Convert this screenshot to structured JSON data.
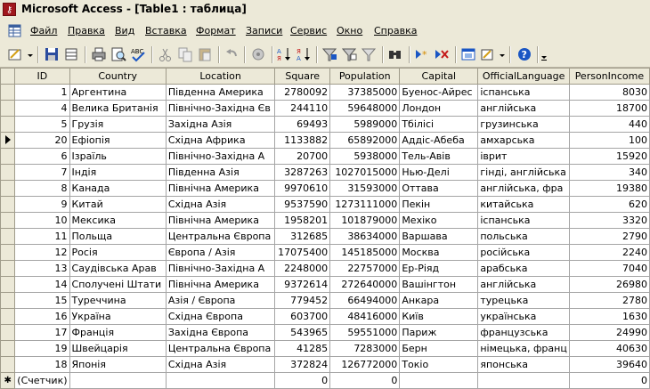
{
  "window": {
    "title": "Microsoft Access - [Table1 : таблица]",
    "app_icon": "access-key-icon"
  },
  "menu": [
    {
      "label": "Файл"
    },
    {
      "label": "Правка"
    },
    {
      "label": "Вид"
    },
    {
      "label": "Вставка"
    },
    {
      "label": "Формат"
    },
    {
      "label": "Записи"
    },
    {
      "label": "Сервис"
    },
    {
      "label": "Окно"
    },
    {
      "label": "Справка"
    }
  ],
  "toolbar": {
    "icons": [
      "design-view-icon",
      "save-icon",
      "print-icon",
      "print-preview-icon",
      "spelling-icon",
      "cut-icon",
      "copy-icon",
      "paste-icon",
      "undo-icon",
      "hyperlink-icon",
      "sort-ascending-icon",
      "sort-descending-icon",
      "filter-by-selection-icon",
      "filter-by-form-icon",
      "apply-filter-icon",
      "find-icon",
      "new-record-icon",
      "delete-record-icon",
      "database-window-icon",
      "new-object-icon",
      "help-icon"
    ]
  },
  "table": {
    "columns": [
      "ID",
      "Country",
      "Location",
      "Square",
      "Population",
      "Capital",
      "OfficialLanguage",
      "PersonIncome"
    ],
    "rows": [
      [
        "1",
        "Аргентина",
        "Південна Америка",
        "2780092",
        "37385000",
        "Буенос-Айрес",
        "іспанська",
        "8030"
      ],
      [
        "4",
        "Велика Британія",
        "Північно-Західна Єв",
        "244110",
        "59648000",
        "Лондон",
        "англійська",
        "18700"
      ],
      [
        "5",
        "Грузія",
        "Західна Азія",
        "69493",
        "5989000",
        "Тбілісі",
        "грузинська",
        "440"
      ],
      [
        "20",
        "Ефіопія",
        "Східна Африка",
        "1133882",
        "65892000",
        "Аддіс-Абеба",
        "амхарська",
        "100"
      ],
      [
        "6",
        "Ізраїль",
        "Північно-Західна А",
        "20700",
        "5938000",
        "Тель-Авів",
        "іврит",
        "15920"
      ],
      [
        "7",
        "Індія",
        "Південна Азія",
        "3287263",
        "1027015000",
        "Нью-Делі",
        "гінді, англійська",
        "340"
      ],
      [
        "8",
        "Канада",
        "Північна Америка",
        "9970610",
        "31593000",
        "Оттава",
        "англійська, фра",
        "19380"
      ],
      [
        "9",
        "Китай",
        "Східна Азія",
        "9537590",
        "1273111000",
        "Пекін",
        "китайська",
        "620"
      ],
      [
        "10",
        "Мексика",
        "Північна Америка",
        "1958201",
        "101879000",
        "Мехіко",
        "іспанська",
        "3320"
      ],
      [
        "11",
        "Польща",
        "Центральна Європа",
        "312685",
        "38634000",
        "Варшава",
        "польська",
        "2790"
      ],
      [
        "12",
        "Росія",
        "Європа / Азія",
        "17075400",
        "145185000",
        "Москва",
        "російська",
        "2240"
      ],
      [
        "13",
        "Саудівська Арав",
        "Північно-Західна А",
        "2248000",
        "22757000",
        "Ер-Ріяд",
        "арабська",
        "7040"
      ],
      [
        "14",
        "Сполучені Штати",
        "Північна Америка",
        "9372614",
        "272640000",
        "Вашінгтон",
        "англійська",
        "26980"
      ],
      [
        "15",
        "Туреччина",
        "Азія / Європа",
        "779452",
        "66494000",
        "Анкара",
        "турецька",
        "2780"
      ],
      [
        "16",
        "Україна",
        "Східна Європа",
        "603700",
        "48416000",
        "Київ",
        "українська",
        "1630"
      ],
      [
        "17",
        "Франція",
        "Західна Європа",
        "543965",
        "59551000",
        "Париж",
        "французська",
        "24990"
      ],
      [
        "19",
        "Швейцарія",
        "Центральна Європа",
        "41285",
        "7283000",
        "Берн",
        "німецька, франц",
        "40630"
      ],
      [
        "18",
        "Японія",
        "Східна Азія",
        "372824",
        "126772000",
        "Токіо",
        "японська",
        "39640"
      ]
    ],
    "current_row_index": 3,
    "new_row": [
      "(Счетчик)",
      "",
      "",
      "0",
      "0",
      "",
      "",
      "0"
    ]
  }
}
